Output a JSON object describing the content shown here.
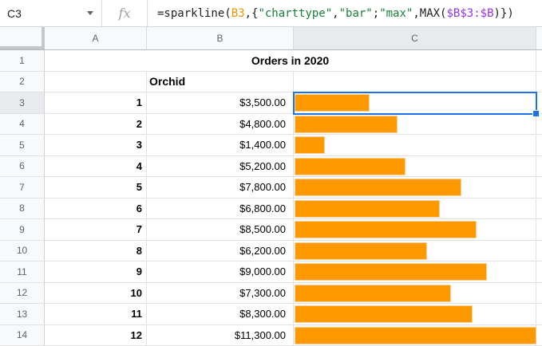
{
  "formula_bar": {
    "cell_ref": "C3",
    "fx_label": "fx",
    "formula_segments": [
      {
        "text": "=sparkline(",
        "color": "#202124"
      },
      {
        "text": "B3",
        "color": "#f09300"
      },
      {
        "text": ",{",
        "color": "#202124"
      },
      {
        "text": "\"charttype\"",
        "color": "#188038"
      },
      {
        "text": ",",
        "color": "#202124"
      },
      {
        "text": "\"bar\"",
        "color": "#188038"
      },
      {
        "text": ";",
        "color": "#202124"
      },
      {
        "text": "\"max\"",
        "color": "#188038"
      },
      {
        "text": ",MAX(",
        "color": "#202124"
      },
      {
        "text": "$B$3:$B",
        "color": "#9334e6"
      },
      {
        "text": ")})",
        "color": "#202124"
      }
    ]
  },
  "grid": {
    "column_headers": [
      "A",
      "B",
      "C"
    ],
    "selected_cell": "C3",
    "selected_column": "C",
    "selected_row": 3,
    "title_row": {
      "row_label": "1",
      "text": "Orders in 2020"
    },
    "label_row": {
      "row_label": "2",
      "b": "Orchid"
    },
    "sparkline_max": 11300,
    "data_rows": [
      {
        "row_label": "3",
        "a": "1",
        "b": "$3,500.00",
        "value": 3500
      },
      {
        "row_label": "4",
        "a": "2",
        "b": "$4,800.00",
        "value": 4800
      },
      {
        "row_label": "5",
        "a": "3",
        "b": "$1,400.00",
        "value": 1400
      },
      {
        "row_label": "6",
        "a": "4",
        "b": "$5,200.00",
        "value": 5200
      },
      {
        "row_label": "7",
        "a": "5",
        "b": "$7,800.00",
        "value": 7800
      },
      {
        "row_label": "8",
        "a": "6",
        "b": "$6,800.00",
        "value": 6800
      },
      {
        "row_label": "9",
        "a": "7",
        "b": "$8,500.00",
        "value": 8500
      },
      {
        "row_label": "10",
        "a": "8",
        "b": "$6,200.00",
        "value": 6200
      },
      {
        "row_label": "11",
        "a": "9",
        "b": "$9,000.00",
        "value": 9000
      },
      {
        "row_label": "12",
        "a": "10",
        "b": "$7,300.00",
        "value": 7300
      },
      {
        "row_label": "13",
        "a": "11",
        "b": "$8,300.00",
        "value": 8300
      },
      {
        "row_label": "14",
        "a": "12",
        "b": "$11,300.00",
        "value": 11300
      }
    ]
  },
  "colors": {
    "bar": "#ff9900",
    "selection": "#1a73e8",
    "header_bg": "#f8f9fa",
    "header_active_bg": "#e8eaed",
    "gridline": "#e2e2e2"
  }
}
